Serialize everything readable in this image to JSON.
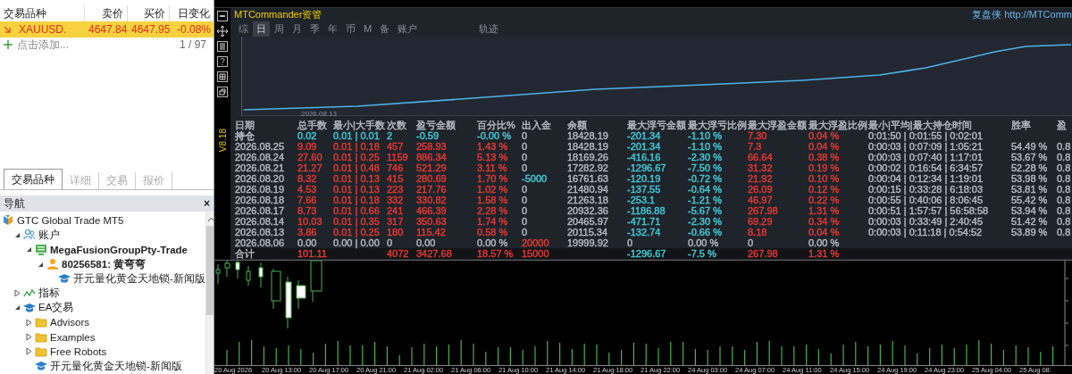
{
  "market_watch": {
    "columns": [
      "交易品种",
      "卖价",
      "买价",
      "日变化"
    ],
    "symbols": [
      {
        "name": "XAUUSD.",
        "bid": "4647.84",
        "ask": "4647.95",
        "change": "-0.08%",
        "selected": true
      }
    ],
    "add_label": "点击添加...",
    "count": "1 / 97"
  },
  "bottom_tabs": [
    {
      "label": "交易品种",
      "selected": true
    },
    {
      "label": "详细",
      "selected": false
    },
    {
      "label": "交易",
      "selected": false
    },
    {
      "label": "报价",
      "selected": false
    }
  ],
  "navigator": {
    "title": "导航",
    "close": "×",
    "tree": [
      {
        "label": "GTC Global Trade MT5",
        "kind": "broker",
        "current": false,
        "children": [
          {
            "label": "账户",
            "kind": "accounts",
            "current": false,
            "expanded": true,
            "children": [
              {
                "label": "MegaFusionGroupPty-Trade",
                "kind": "server",
                "current": true,
                "expanded": true,
                "children": [
                  {
                    "label": "80256581: 黄弯弯",
                    "kind": "user",
                    "current": true,
                    "expanded": true,
                    "children": [
                      {
                        "label": "开元量化黄金天地锁-新闻版",
                        "kind": "expert",
                        "current": false
                      }
                    ]
                  }
                ]
              }
            ]
          },
          {
            "label": "指标",
            "kind": "indicators",
            "current": false,
            "expanded": false
          },
          {
            "label": "EA交易",
            "kind": "expert",
            "current": false,
            "expanded": true,
            "children": [
              {
                "label": "Advisors",
                "kind": "folder",
                "current": false,
                "expanded": false
              },
              {
                "label": "Examples",
                "kind": "folder",
                "current": false,
                "expanded": false
              },
              {
                "label": "Free Robots",
                "kind": "folder",
                "current": false,
                "expanded": false
              },
              {
                "label": "开元量化黄金天地锁-新闻版",
                "kind": "expert",
                "current": false
              }
            ]
          }
        ]
      }
    ]
  },
  "commander": {
    "title": "MTCommander资管",
    "link": "复盘侠 http://MTComm",
    "version": "V8.18",
    "tabs": [
      {
        "label": "综",
        "selected": false
      },
      {
        "label": "日",
        "selected": true
      },
      {
        "label": "周",
        "selected": false
      },
      {
        "label": "月",
        "selected": false
      },
      {
        "label": "季",
        "selected": false
      },
      {
        "label": "年",
        "selected": false
      },
      {
        "label": "币",
        "selected": false
      },
      {
        "label": "M",
        "selected": false
      },
      {
        "label": "备",
        "selected": false
      },
      {
        "label": "账户",
        "selected": false
      },
      {
        "label": "轨迹",
        "selected": false
      }
    ],
    "equity_chart": {
      "date_label": "2026.08.13"
    },
    "table": {
      "columns": [
        "日期",
        "总手数",
        "最小|大手数",
        "次数",
        "盈亏金额",
        "百分比%",
        "出入金",
        "余额",
        "最大浮亏金额",
        "最大浮亏比例",
        "最大浮盈金额",
        "最大浮盈比例",
        "最小|平均|最大持仓时间",
        "胜率",
        "盈"
      ],
      "rows": [
        {
          "kind": "position",
          "cells": [
            {
              "text": "持仓",
              "color": "#c4c8d0"
            },
            {
              "text": "0.02",
              "color": "#45c9d6"
            },
            {
              "text": "0.01 | 0.01",
              "color": "#45c9d6"
            },
            {
              "text": "2",
              "color": "#45c9d6"
            },
            {
              "text": "-0.59",
              "color": "#45c9d6"
            },
            {
              "text": "-0.00 %",
              "color": "#45c9d6"
            },
            {
              "text": "0",
              "color": "#b4b8c0"
            },
            {
              "text": "18428.19",
              "color": "#b4b8c0"
            },
            {
              "text": "-201.34",
              "color": "#45c9d6"
            },
            {
              "text": "-1.10 %",
              "color": "#45c9d6"
            },
            {
              "text": "7.30",
              "color": "#e03a35"
            },
            {
              "text": "0.04 %",
              "color": "#e03a35"
            },
            {
              "text": "0:01:50 | 0:01:55 | 0:02:01",
              "color": "#b4b8c0"
            },
            null,
            null
          ]
        },
        {
          "kind": "day",
          "cells": [
            {
              "text": "2026.08.25",
              "color": "#b4b8c0"
            },
            {
              "text": "9.09",
              "color": "#e03a35"
            },
            {
              "text": "0.01 | 0.18",
              "color": "#e03a35"
            },
            {
              "text": "457",
              "color": "#e03a35"
            },
            {
              "text": "258.93",
              "color": "#e03a35"
            },
            {
              "text": "1.43 %",
              "color": "#e03a35"
            },
            {
              "text": "0",
              "color": "#b4b8c0"
            },
            {
              "text": "18428.19",
              "color": "#b4b8c0"
            },
            {
              "text": "-201.34",
              "color": "#45c9d6"
            },
            {
              "text": "-1.10 %",
              "color": "#45c9d6"
            },
            {
              "text": "7.3",
              "color": "#e03a35"
            },
            {
              "text": "0.04 %",
              "color": "#e03a35"
            },
            {
              "text": "0:00:03 | 0:07:09 | 1:05:21",
              "color": "#b4b8c0"
            },
            {
              "text": "54.49 %",
              "color": "#b4b8c0"
            },
            {
              "text": "0.8",
              "color": "#b4b8c0"
            }
          ]
        },
        {
          "kind": "day",
          "cells": [
            {
              "text": "2026.08.24",
              "color": "#b4b8c0"
            },
            {
              "text": "27.60",
              "color": "#e03a35"
            },
            {
              "text": "0.01 | 0.25",
              "color": "#e03a35"
            },
            {
              "text": "1159",
              "color": "#e03a35"
            },
            {
              "text": "886.34",
              "color": "#e03a35"
            },
            {
              "text": "5.13 %",
              "color": "#e03a35"
            },
            {
              "text": "0",
              "color": "#b4b8c0"
            },
            {
              "text": "18169.26",
              "color": "#b4b8c0"
            },
            {
              "text": "-416.16",
              "color": "#45c9d6"
            },
            {
              "text": "-2.30 %",
              "color": "#45c9d6"
            },
            {
              "text": "66.64",
              "color": "#e03a35"
            },
            {
              "text": "0.38 %",
              "color": "#e03a35"
            },
            {
              "text": "0:00:03 | 0:07:40 | 1:17:01",
              "color": "#b4b8c0"
            },
            {
              "text": "53.67 %",
              "color": "#b4b8c0"
            },
            {
              "text": "0.8",
              "color": "#b4b8c0"
            }
          ]
        },
        {
          "kind": "day",
          "cells": [
            {
              "text": "2026.08.21",
              "color": "#b4b8c0"
            },
            {
              "text": "21.27",
              "color": "#e03a35"
            },
            {
              "text": "0.01 | 0.48",
              "color": "#e03a35"
            },
            {
              "text": "746",
              "color": "#e03a35"
            },
            {
              "text": "521.29",
              "color": "#e03a35"
            },
            {
              "text": "3.11 %",
              "color": "#e03a35"
            },
            {
              "text": "0",
              "color": "#b4b8c0"
            },
            {
              "text": "17282.92",
              "color": "#b4b8c0"
            },
            {
              "text": "-1296.67",
              "color": "#45c9d6"
            },
            {
              "text": "-7.50 %",
              "color": "#45c9d6"
            },
            {
              "text": "31.32",
              "color": "#e03a35"
            },
            {
              "text": "0.19 %",
              "color": "#e03a35"
            },
            {
              "text": "0:00:02 | 0:16:54 | 6:34:57",
              "color": "#b4b8c0"
            },
            {
              "text": "52.28 %",
              "color": "#b4b8c0"
            },
            {
              "text": "0.8",
              "color": "#b4b8c0"
            }
          ]
        },
        {
          "kind": "day",
          "cells": [
            {
              "text": "2026.08.20",
              "color": "#b4b8c0"
            },
            {
              "text": "8.32",
              "color": "#e03a35"
            },
            {
              "text": "0.01 | 0.13",
              "color": "#e03a35"
            },
            {
              "text": "415",
              "color": "#e03a35"
            },
            {
              "text": "280.69",
              "color": "#e03a35"
            },
            {
              "text": "1.70 %",
              "color": "#e03a35"
            },
            {
              "text": "-5000",
              "color": "#45c9d6"
            },
            {
              "text": "16761.63",
              "color": "#b4b8c0"
            },
            {
              "text": "-120.19",
              "color": "#45c9d6"
            },
            {
              "text": "-0.72 %",
              "color": "#45c9d6"
            },
            {
              "text": "21.92",
              "color": "#e03a35"
            },
            {
              "text": "0.10 %",
              "color": "#e03a35"
            },
            {
              "text": "0:00:04 | 0:12:34 | 1:19:01",
              "color": "#b4b8c0"
            },
            {
              "text": "53.98 %",
              "color": "#b4b8c0"
            },
            {
              "text": "0.8",
              "color": "#b4b8c0"
            }
          ]
        },
        {
          "kind": "day",
          "cells": [
            {
              "text": "2026.08.19",
              "color": "#b4b8c0"
            },
            {
              "text": "4.53",
              "color": "#e03a35"
            },
            {
              "text": "0.01 | 0.13",
              "color": "#e03a35"
            },
            {
              "text": "223",
              "color": "#e03a35"
            },
            {
              "text": "217.76",
              "color": "#e03a35"
            },
            {
              "text": "1.02 %",
              "color": "#e03a35"
            },
            {
              "text": "0",
              "color": "#b4b8c0"
            },
            {
              "text": "21480.94",
              "color": "#b4b8c0"
            },
            {
              "text": "-137.55",
              "color": "#45c9d6"
            },
            {
              "text": "-0.64 %",
              "color": "#45c9d6"
            },
            {
              "text": "26.09",
              "color": "#e03a35"
            },
            {
              "text": "0.12 %",
              "color": "#e03a35"
            },
            {
              "text": "0:00:15 | 0:33:28 | 6:18:03",
              "color": "#b4b8c0"
            },
            {
              "text": "53.81 %",
              "color": "#b4b8c0"
            },
            {
              "text": "0.8",
              "color": "#b4b8c0"
            }
          ]
        },
        {
          "kind": "day",
          "cells": [
            {
              "text": "2026.08.18",
              "color": "#b4b8c0"
            },
            {
              "text": "7.66",
              "color": "#e03a35"
            },
            {
              "text": "0.01 | 0.18",
              "color": "#e03a35"
            },
            {
              "text": "332",
              "color": "#e03a35"
            },
            {
              "text": "330.82",
              "color": "#e03a35"
            },
            {
              "text": "1.58 %",
              "color": "#e03a35"
            },
            {
              "text": "0",
              "color": "#b4b8c0"
            },
            {
              "text": "21263.18",
              "color": "#b4b8c0"
            },
            {
              "text": "-253.1",
              "color": "#45c9d6"
            },
            {
              "text": "-1.21 %",
              "color": "#45c9d6"
            },
            {
              "text": "46.97",
              "color": "#e03a35"
            },
            {
              "text": "0.22 %",
              "color": "#e03a35"
            },
            {
              "text": "0:00:55 | 0:40:06 | 8:06:45",
              "color": "#b4b8c0"
            },
            {
              "text": "55.42 %",
              "color": "#b4b8c0"
            },
            {
              "text": "0.8",
              "color": "#b4b8c0"
            }
          ]
        },
        {
          "kind": "day",
          "cells": [
            {
              "text": "2026.08.17",
              "color": "#b4b8c0"
            },
            {
              "text": "8.73",
              "color": "#e03a35"
            },
            {
              "text": "0.01 | 0.66",
              "color": "#e03a35"
            },
            {
              "text": "241",
              "color": "#e03a35"
            },
            {
              "text": "466.39",
              "color": "#e03a35"
            },
            {
              "text": "2.28 %",
              "color": "#e03a35"
            },
            {
              "text": "0",
              "color": "#b4b8c0"
            },
            {
              "text": "20932.36",
              "color": "#b4b8c0"
            },
            {
              "text": "-1186.88",
              "color": "#45c9d6"
            },
            {
              "text": "-5.67 %",
              "color": "#45c9d6"
            },
            {
              "text": "267.98",
              "color": "#e03a35"
            },
            {
              "text": "1.31 %",
              "color": "#e03a35"
            },
            {
              "text": "0:00:51 | 1:57:57 | 56:58:58",
              "color": "#b4b8c0"
            },
            {
              "text": "53.94 %",
              "color": "#b4b8c0"
            },
            {
              "text": "0.8",
              "color": "#b4b8c0"
            }
          ]
        },
        {
          "kind": "day",
          "cells": [
            {
              "text": "2026.08.14",
              "color": "#b4b8c0"
            },
            {
              "text": "10.03",
              "color": "#e03a35"
            },
            {
              "text": "0.01 | 0.35",
              "color": "#e03a35"
            },
            {
              "text": "317",
              "color": "#e03a35"
            },
            {
              "text": "350.63",
              "color": "#e03a35"
            },
            {
              "text": "1.74 %",
              "color": "#e03a35"
            },
            {
              "text": "0",
              "color": "#b4b8c0"
            },
            {
              "text": "20465.97",
              "color": "#b4b8c0"
            },
            {
              "text": "-471.71",
              "color": "#45c9d6"
            },
            {
              "text": "-2.30 %",
              "color": "#45c9d6"
            },
            {
              "text": "69.29",
              "color": "#e03a35"
            },
            {
              "text": "0.34 %",
              "color": "#e03a35"
            },
            {
              "text": "0:00:03 | 0:33:49 | 2:40:45",
              "color": "#b4b8c0"
            },
            {
              "text": "51.42 %",
              "color": "#b4b8c0"
            },
            {
              "text": "0.8",
              "color": "#b4b8c0"
            }
          ]
        },
        {
          "kind": "day",
          "cells": [
            {
              "text": "2026.08.13",
              "color": "#b4b8c0"
            },
            {
              "text": "3.86",
              "color": "#e03a35"
            },
            {
              "text": "0.01 | 0.25",
              "color": "#e03a35"
            },
            {
              "text": "180",
              "color": "#e03a35"
            },
            {
              "text": "115.42",
              "color": "#e03a35"
            },
            {
              "text": "0.58 %",
              "color": "#e03a35"
            },
            {
              "text": "0",
              "color": "#b4b8c0"
            },
            {
              "text": "20115.34",
              "color": "#b4b8c0"
            },
            {
              "text": "-132.74",
              "color": "#45c9d6"
            },
            {
              "text": "-0.66 %",
              "color": "#45c9d6"
            },
            {
              "text": "8.18",
              "color": "#e03a35"
            },
            {
              "text": "0.04 %",
              "color": "#e03a35"
            },
            {
              "text": "0:00:03 | 0:11:18 | 0:54:52",
              "color": "#b4b8c0"
            },
            {
              "text": "53.89 %",
              "color": "#b4b8c0"
            },
            {
              "text": "0.8",
              "color": "#b4b8c0"
            }
          ]
        },
        {
          "kind": "day",
          "cells": [
            {
              "text": "2026.08.06",
              "color": "#b4b8c0"
            },
            {
              "text": "0.00",
              "color": "#b4b8c0"
            },
            {
              "text": "0.00 | 0.00",
              "color": "#b4b8c0"
            },
            {
              "text": "0",
              "color": "#b4b8c0"
            },
            {
              "text": "0.00",
              "color": "#b4b8c0"
            },
            {
              "text": "0.00 %",
              "color": "#b4b8c0"
            },
            {
              "text": "20000",
              "color": "#e03a35"
            },
            {
              "text": "19999.92",
              "color": "#b4b8c0"
            },
            {
              "text": "0",
              "color": "#b4b8c0"
            },
            {
              "text": "0.00 %",
              "color": "#b4b8c0"
            },
            {
              "text": "0",
              "color": "#b4b8c0"
            },
            {
              "text": "0.00 %",
              "color": "#b4b8c0"
            },
            null,
            null,
            null
          ]
        },
        {
          "kind": "total",
          "cells": [
            {
              "text": "合计",
              "color": "#b4b8c0"
            },
            {
              "text": "101.11",
              "color": "#e03a35"
            },
            null,
            {
              "text": "4072",
              "color": "#e03a35"
            },
            {
              "text": "3427.68",
              "color": "#e03a35"
            },
            {
              "text": "18.57 %",
              "color": "#e03a35"
            },
            {
              "text": "15000",
              "color": "#e03a35"
            },
            null,
            {
              "text": "-1296.67",
              "color": "#45c9d6"
            },
            {
              "text": "-7.5 %",
              "color": "#45c9d6"
            },
            {
              "text": "267.98",
              "color": "#e03a35"
            },
            {
              "text": "1.31 %",
              "color": "#e03a35"
            },
            null,
            null,
            null
          ]
        }
      ]
    }
  },
  "price_chart": {
    "time_labels": [
      "20 Aug 2026",
      "20 Aug 13:00",
      "20 Aug 17:00",
      "20 Aug 21:00",
      "21 Aug 02:00",
      "21 Aug 06:00",
      "21 Aug 10:00",
      "21 Aug 14:00",
      "21 Aug 18:00",
      "21 Aug 22:00",
      "24 Aug 03:00",
      "24 Aug 07:00",
      "24 Aug 11:00",
      "24 Aug 15:00",
      "24 Aug 19:00",
      "24 Aug 23:00",
      "25 Aug 04:00",
      "25 Aug 08:"
    ]
  }
}
